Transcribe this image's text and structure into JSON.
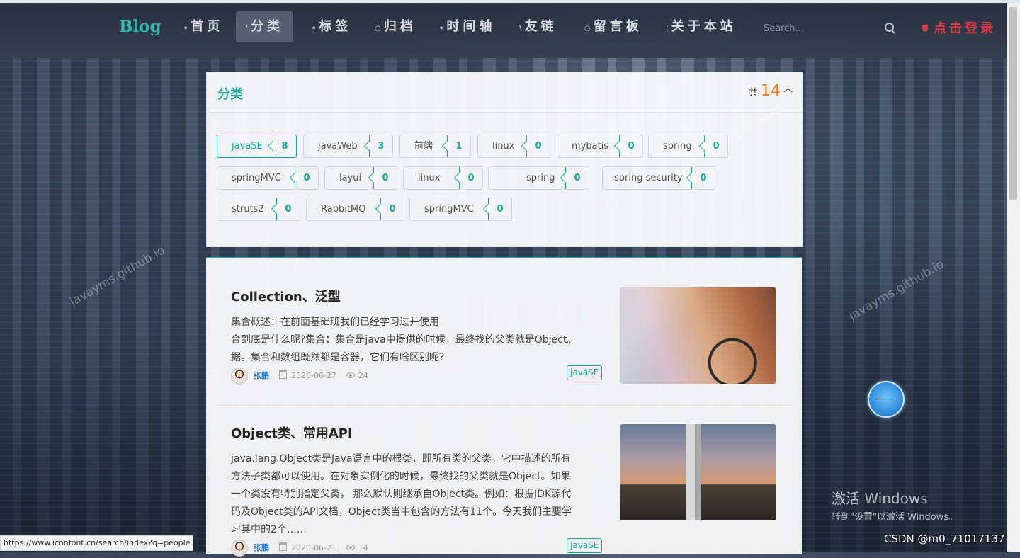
{
  "navbar": {
    "brand": "Blog",
    "items": [
      {
        "label": "首页",
        "active": false
      },
      {
        "label": "分类",
        "active": true
      },
      {
        "label": "标签",
        "active": false
      },
      {
        "label": "归档",
        "active": false
      },
      {
        "label": "时间轴",
        "active": false
      },
      {
        "label": "友链",
        "active": false
      },
      {
        "label": "留言板",
        "active": false
      },
      {
        "label": "关于本站",
        "active": false
      }
    ],
    "search_placeholder": "Search...",
    "login_label": "点击登录"
  },
  "categories": {
    "title": "分类",
    "count_prefix": "共",
    "count": "14",
    "count_suffix": "个",
    "tags": [
      {
        "name": "javaSE",
        "count": "8"
      },
      {
        "name": "javaWeb",
        "count": "3"
      },
      {
        "name": "前端",
        "count": "1"
      },
      {
        "name": "linux",
        "count": "0"
      },
      {
        "name": "mybatis",
        "count": "0"
      },
      {
        "name": "spring",
        "count": "0"
      },
      {
        "name": "springMVC",
        "count": "0"
      },
      {
        "name": "layui",
        "count": "0"
      },
      {
        "name": "linux",
        "count": "0"
      },
      {
        "name": "spring",
        "count": "0"
      },
      {
        "name": "spring security",
        "count": "0"
      },
      {
        "name": "struts2",
        "count": "0"
      },
      {
        "name": "RabbitMQ",
        "count": "0"
      },
      {
        "name": "springMVC",
        "count": "0"
      }
    ]
  },
  "articles": [
    {
      "title": "Collection、泛型",
      "desc_lines": [
        "集合概述：在前面基础班我们已经学习过并使用",
        "合到底是什么呢?集合：集合是java中提供的时候，最终找的父类就是Object。",
        "据。集合和数组既然都是容器，它们有啥区别呢？"
      ],
      "author": "张鹏",
      "date": "2020-06-27",
      "views": "24",
      "tag": "javaSE"
    },
    {
      "title": "Object类、常用API",
      "desc_lines": [
        "java.lang.Object类是Java语言中的根类，即所有类的父类。它中描述的所有",
        "方法子类都可以使用。在对象实例化的时候，最终找的父类就是Object。如果",
        "一个类没有特别指定父类， 那么默认则继承自Object类。例如：根据JDK源代",
        "码及Object类的API文档，Object类当中包含的方法有11个。今天我们主要学",
        "习其中的2个……"
      ],
      "author": "张鹏",
      "date": "2020-06-21",
      "views": "14",
      "tag": "javaSE"
    }
  ],
  "statusbar": "https://www.iconfont.cn/search/index?q=people",
  "windows_activation": {
    "title": "激活 Windows",
    "subtitle": "转到\"设置\"以激活 Windows。"
  },
  "csdn_watermark": "CSDN @m0_71017137",
  "site_watermark": "javayms.github.io",
  "colors": {
    "accent": "#19a99c",
    "count": "#e67e22",
    "login": "#d63a4a"
  }
}
